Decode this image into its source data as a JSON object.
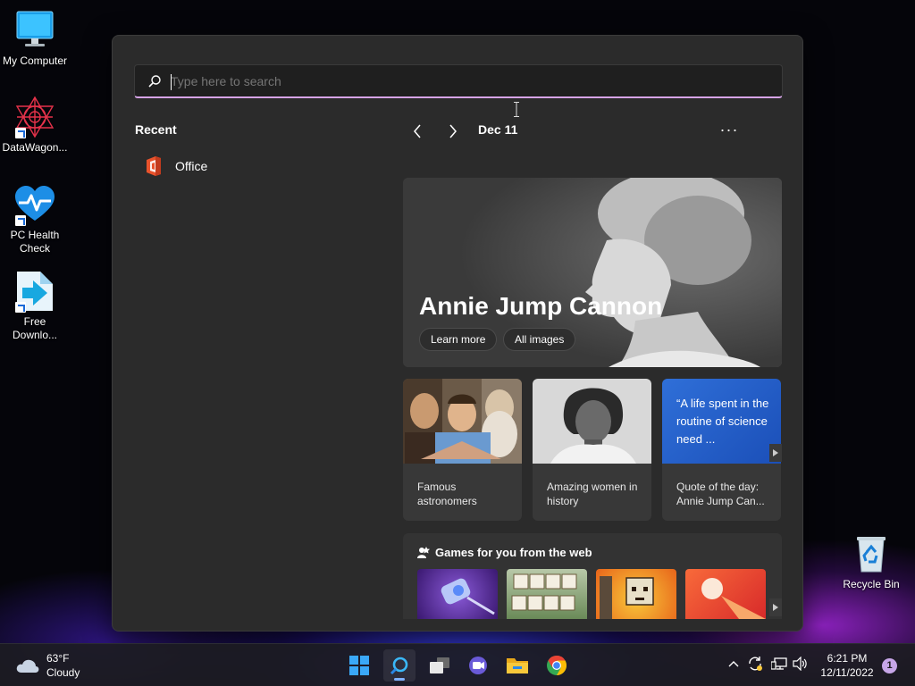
{
  "desktop": {
    "icons": [
      {
        "label": "My Computer"
      },
      {
        "label": "DataWagon..."
      },
      {
        "label": "PC Health Check"
      },
      {
        "label": "Free Downlo..."
      },
      {
        "label": "Recycle Bin"
      }
    ]
  },
  "search": {
    "placeholder": "Type here to search"
  },
  "recent": {
    "title": "Recent",
    "items": [
      {
        "label": "Office",
        "icon": "office-icon"
      }
    ]
  },
  "highlights": {
    "date": "Dec 11",
    "more": "···",
    "hero": {
      "title": "Annie Jump Cannon",
      "learn_more": "Learn more",
      "all_images": "All images"
    },
    "cards": [
      {
        "caption": "Famous astronomers"
      },
      {
        "caption": "Amazing women in history"
      },
      {
        "quote": "“A life spent in the routine of science need ...",
        "caption": "Quote of the day: Annie Jump Can..."
      }
    ],
    "games": {
      "title": "Games for you from the web"
    }
  },
  "taskbar": {
    "weather": {
      "temp": "63°F",
      "condition": "Cloudy"
    },
    "clock": {
      "time": "6:21 PM",
      "date": "12/11/2022"
    },
    "notifications": "1"
  }
}
